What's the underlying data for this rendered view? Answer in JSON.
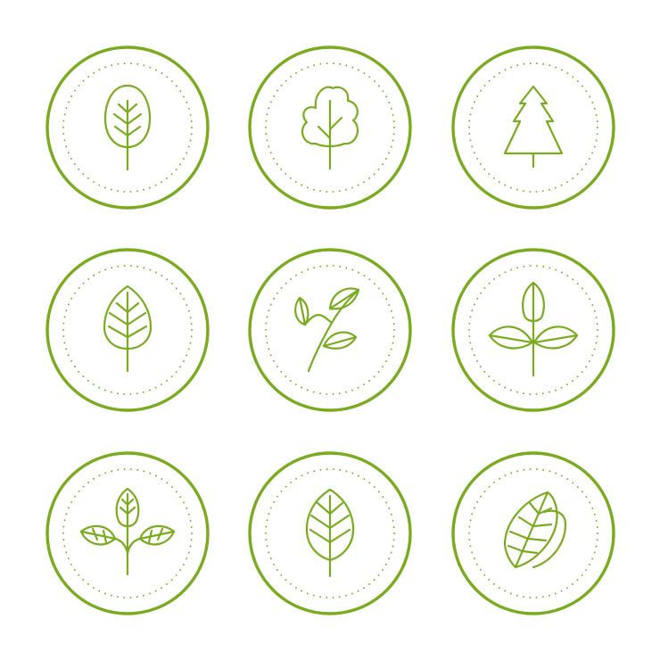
{
  "colors": {
    "accent": "#7aab1e",
    "background": "#ffffff"
  },
  "badges": [
    {
      "icon": "oval-leaf-icon"
    },
    {
      "icon": "deciduous-tree-icon"
    },
    {
      "icon": "pine-tree-icon"
    },
    {
      "icon": "pointed-leaf-icon"
    },
    {
      "icon": "branch-icon"
    },
    {
      "icon": "three-leaf-sprout-icon"
    },
    {
      "icon": "sprout-icon"
    },
    {
      "icon": "leaf-icon"
    },
    {
      "icon": "double-leaf-icon"
    }
  ]
}
